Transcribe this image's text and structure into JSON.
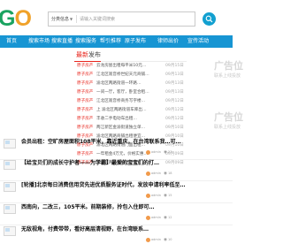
{
  "header": {
    "logo_part1": "G",
    "logo_part2": "O",
    "search": {
      "select_label": "分类信息",
      "placeholder": "请输入关键词搜索"
    }
  },
  "nav": {
    "items": [
      "首页",
      "搜索市场",
      "搜索直播",
      "搜索服务",
      "帮引推荐",
      "原子发布",
      "律师出价",
      "宣传活动"
    ]
  },
  "release": {
    "title_highlight": "最新",
    "title_rest": "发布",
    "items": [
      {
        "cat": "原子房产",
        "title": "云龙房屋出租每平米10元…",
        "date": "09月15日"
      },
      {
        "cat": "原子房产",
        "title": "江北区观音桥世纪天元商铺…",
        "date": "09月13日"
      },
      {
        "cat": "原子房产",
        "title": "渝北区两路街道一环路…",
        "date": "09月13日"
      },
      {
        "cat": "原子房产",
        "title": "一间一厅，客厅，卧室合租…",
        "date": "09月13日"
      },
      {
        "cat": "原子房产",
        "title": "江北区观音桥商务写字楼…",
        "date": "09月12日"
      },
      {
        "cat": "原子房产",
        "title": "上 渝北区两路街道车库出…",
        "date": "09月12日"
      },
      {
        "cat": "原子房产",
        "title": "丰收二手电动车出租…",
        "date": "09月12日"
      },
      {
        "cat": "原子房产",
        "title": "两江新区金渝街道独立单…",
        "date": "09月10日"
      },
      {
        "cat": "原子房产",
        "title": "渝北区两路商铺出租便宜…",
        "date": "09月10日"
      },
      {
        "cat": "原子房产",
        "title": "渝北区两路街道门面出租…",
        "date": "09月10日"
      },
      {
        "cat": "原子房产",
        "title": "一年租金4万元，价格实惠…",
        "date": "09月09日"
      },
      {
        "cat": "原子房产",
        "title": "渝北区两路商铺出租便宜…",
        "date": "09月09日"
      }
    ]
  },
  "ads": [
    {
      "text": "广告位",
      "sub": "联系上线投放"
    },
    {
      "text": "广告位",
      "sub": "联系上线投放"
    }
  ],
  "news": [
    {
      "title": "会员出租：空旷房屋面积108平米，靠近重庆，在台湾联系我…可…",
      "author": "admin",
      "views": "23"
    },
    {
      "title": "【给宝贝们的成长守护者——为学霸】最爱的宝宝们的打…",
      "author": "admin",
      "views": "18"
    },
    {
      "title": "[轮播]北京每日消费信用贷先进优质服务证时代，发放申请利率低至…",
      "author": "admin",
      "views": "15"
    },
    {
      "title": "西南向，二改三，105平米。前期装修，拎包入住即可…",
      "author": "admin",
      "views": "12"
    },
    {
      "title": "无敌视角，付费带带，看好高层清视野，在台湾联系…",
      "author": "admin",
      "views": "10"
    }
  ],
  "colors": {
    "nav_bg": "#1795d3",
    "accent_red": "#e8261d",
    "logo_green": "#1aa360",
    "logo_orange": "#f0a22a"
  }
}
